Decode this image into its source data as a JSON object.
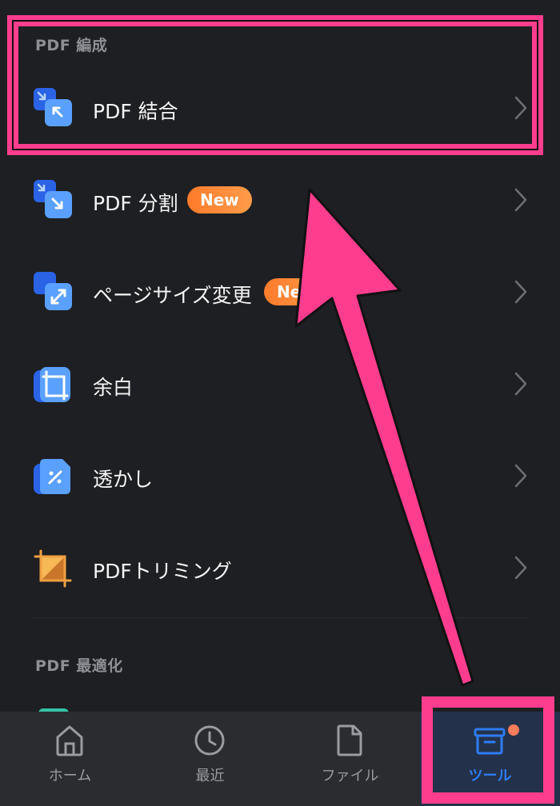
{
  "sections": [
    {
      "title": "PDF 編成"
    },
    {
      "title": "PDF 最適化"
    }
  ],
  "tools": [
    {
      "label": "PDF 結合",
      "icon": "merge-icon"
    },
    {
      "label": "PDF 分割",
      "icon": "split-icon",
      "badge": "New"
    },
    {
      "label": "ページサイズ変更",
      "icon": "resize-icon",
      "badge": "New"
    },
    {
      "label": "余白",
      "icon": "crop-margin-icon"
    },
    {
      "label": "透かし",
      "icon": "watermark-icon"
    },
    {
      "label": "PDFトリミング",
      "icon": "trim-icon"
    }
  ],
  "bottom_nav": [
    {
      "label": "ホーム",
      "icon": "home-icon"
    },
    {
      "label": "最近",
      "icon": "clock-icon"
    },
    {
      "label": "ファイル",
      "icon": "file-icon"
    },
    {
      "label": "ツール",
      "icon": "toolbox-icon",
      "active": true
    }
  ],
  "colors": {
    "background": "#1e1f22",
    "accent": "#2f7cf6",
    "badge": "#ff8a3c",
    "annotation": "#ff3d8e"
  }
}
